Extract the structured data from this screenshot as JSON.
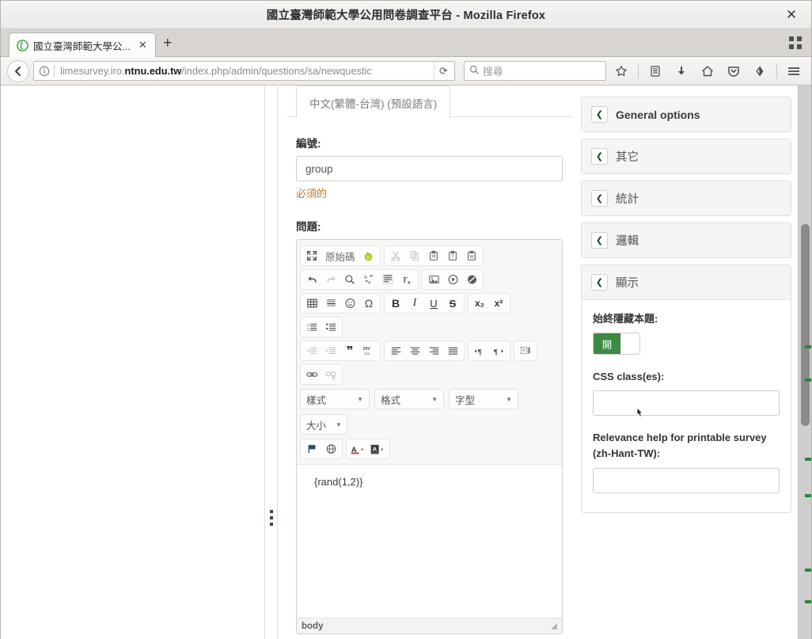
{
  "window": {
    "title": "國立臺灣師範大學公用問卷調查平台 - Mozilla Firefox",
    "close_label": "✕"
  },
  "tabstrip": {
    "tab_label": "國立臺灣師範大學公...",
    "tab_close": "✕",
    "new_tab": "+",
    "grid_button": "grid-icon"
  },
  "navbar": {
    "back": "‹",
    "identity_icon": "info-icon",
    "url_prefix": "limesurvey.iro.",
    "url_domain": "ntnu.edu.tw",
    "url_path": "/index.php/admin/questions/sa/newquestic",
    "reload": "⟳",
    "search_placeholder": "搜尋",
    "icons": [
      "star-icon",
      "library-icon",
      "downloads-icon",
      "home-icon",
      "pocket-icon",
      "sync-icon",
      "menu-icon"
    ]
  },
  "main": {
    "language_tab": "中文(繁體-台灣) (預設語言)",
    "code_label": "編號:",
    "code_value": "group",
    "code_help": "必須的",
    "question_label": "問題:",
    "editor": {
      "toolbar": {
        "row1_group1": [
          {
            "icon": "maximize-icon",
            "glyph": "⛶"
          },
          {
            "icon": "source-icon",
            "glyph": "原始碼"
          },
          {
            "icon": "template-icon",
            "glyph": "◓"
          }
        ],
        "row1_group2": [
          {
            "icon": "cut-icon",
            "glyph": "✂"
          },
          {
            "icon": "copy-icon",
            "glyph": "🗐"
          },
          {
            "icon": "paste-icon",
            "glyph": "📋"
          },
          {
            "icon": "paste-text-icon",
            "glyph": "T"
          },
          {
            "icon": "paste-word-icon",
            "glyph": "W"
          }
        ],
        "row2_group1": [
          {
            "icon": "undo-icon",
            "glyph": "↶"
          },
          {
            "icon": "redo-icon",
            "glyph": "↷"
          },
          {
            "icon": "find-icon",
            "glyph": "🔍"
          },
          {
            "icon": "replace-icon",
            "glyph": "ba"
          },
          {
            "icon": "select-all-icon",
            "glyph": "▤"
          },
          {
            "icon": "remove-format-icon",
            "glyph": "Tx"
          }
        ],
        "row2_group2": [
          {
            "icon": "image-icon",
            "glyph": "🖼"
          },
          {
            "icon": "media-icon",
            "glyph": "▶"
          },
          {
            "icon": "flash-icon",
            "glyph": "◍"
          }
        ],
        "row3_group1": [
          {
            "icon": "table-icon",
            "glyph": "▦"
          },
          {
            "icon": "horizontal-rule-icon",
            "glyph": "▤"
          },
          {
            "icon": "smiley-icon",
            "glyph": "☺"
          },
          {
            "icon": "special-char-icon",
            "glyph": "Ω"
          }
        ],
        "row3_group2": [
          {
            "icon": "bold-icon",
            "glyph": "B"
          },
          {
            "icon": "italic-icon",
            "glyph": "I"
          },
          {
            "icon": "underline-icon",
            "glyph": "U"
          },
          {
            "icon": "strike-icon",
            "glyph": "S"
          }
        ],
        "row3_group3": [
          {
            "icon": "subscript-icon",
            "glyph": "x₂"
          },
          {
            "icon": "superscript-icon",
            "glyph": "x²"
          }
        ],
        "row3_group4": [
          {
            "icon": "numbered-list-icon",
            "glyph": "⒈▤"
          },
          {
            "icon": "bulleted-list-icon",
            "glyph": "▪▤"
          }
        ],
        "row4_group1": [
          {
            "icon": "outdent-icon",
            "glyph": "⇤▤"
          },
          {
            "icon": "indent-icon",
            "glyph": "⇥▤"
          },
          {
            "icon": "blockquote-icon",
            "glyph": "❞"
          },
          {
            "icon": "div-container-icon",
            "glyph": "DIV"
          }
        ],
        "row4_group2": [
          {
            "icon": "align-left-icon",
            "glyph": "▤"
          },
          {
            "icon": "align-center-icon",
            "glyph": "▤"
          },
          {
            "icon": "align-right-icon",
            "glyph": "▤"
          },
          {
            "icon": "justify-icon",
            "glyph": "▤"
          }
        ],
        "row4_group3": [
          {
            "icon": "ltr-icon",
            "glyph": "¶"
          },
          {
            "icon": "rtl-icon",
            "glyph": "¶"
          }
        ],
        "row4_group4": [
          {
            "icon": "show-blocks-icon",
            "glyph": "▢"
          }
        ],
        "row5_group1": [
          {
            "icon": "link-icon",
            "glyph": "🔗"
          },
          {
            "icon": "unlink-icon",
            "glyph": "🔗"
          }
        ],
        "row7_group1": [
          {
            "icon": "flag-icon",
            "glyph": "⚑"
          },
          {
            "icon": "globe-icon",
            "glyph": "🌐"
          }
        ],
        "row7_group2": [
          {
            "icon": "text-color-icon",
            "glyph": "A"
          },
          {
            "icon": "bg-color-icon",
            "glyph": "A"
          }
        ]
      },
      "selects": [
        {
          "label": "樣式",
          "arrow": "▼"
        },
        {
          "label": "格式",
          "arrow": "▼"
        },
        {
          "label": "字型",
          "arrow": "▼"
        },
        {
          "label": "大小",
          "arrow": "▼"
        }
      ],
      "content": "{rand(1,2)}",
      "status_path": "body"
    }
  },
  "sidebar": {
    "panels": [
      {
        "title": "General options",
        "chevron": "❮",
        "cjk": false
      },
      {
        "title": "其它",
        "chevron": "❮",
        "cjk": true
      },
      {
        "title": "統計",
        "chevron": "❮",
        "cjk": true
      },
      {
        "title": "邏輯",
        "chevron": "❮",
        "cjk": true
      },
      {
        "title": "顯示",
        "chevron": "❮",
        "cjk": true
      }
    ],
    "display": {
      "always_hide_label": "始終隱藏本題:",
      "toggle_on_text": "開",
      "css_class_label": "CSS class(es):",
      "css_class_value": "",
      "relevance_label": "Relevance help for printable survey (zh-Hant-TW):",
      "relevance_value": ""
    }
  },
  "colors": {
    "accent_green": "#3c8b41",
    "required_orange": "#c0742c",
    "panel_header": "#f5f5f5"
  }
}
